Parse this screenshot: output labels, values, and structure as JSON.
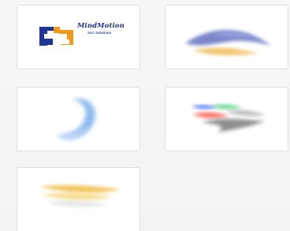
{
  "logos": [
    {
      "name": "MindMotion",
      "brand_text": "MindMotion",
      "sub_text": "SoC Solutions",
      "colors": {
        "primary": "#1f3594",
        "accent": "#f29a18"
      }
    },
    {
      "name": "blue-gold-swirl-logo",
      "colors": {
        "primary": "#4959b5",
        "accent": "#f0b64a"
      }
    },
    {
      "name": "blue-crescent-logo",
      "colors": {
        "primary": "#6fa7e8",
        "accent": "#c8daf8"
      }
    },
    {
      "name": "multicolor-wave-logo",
      "colors": {
        "primary": "#6f6f6f",
        "accent": "#ff3a28"
      }
    },
    {
      "name": "gold-wave-logo",
      "colors": {
        "primary": "#f0bb3d",
        "accent": "#f7d779"
      }
    }
  ]
}
